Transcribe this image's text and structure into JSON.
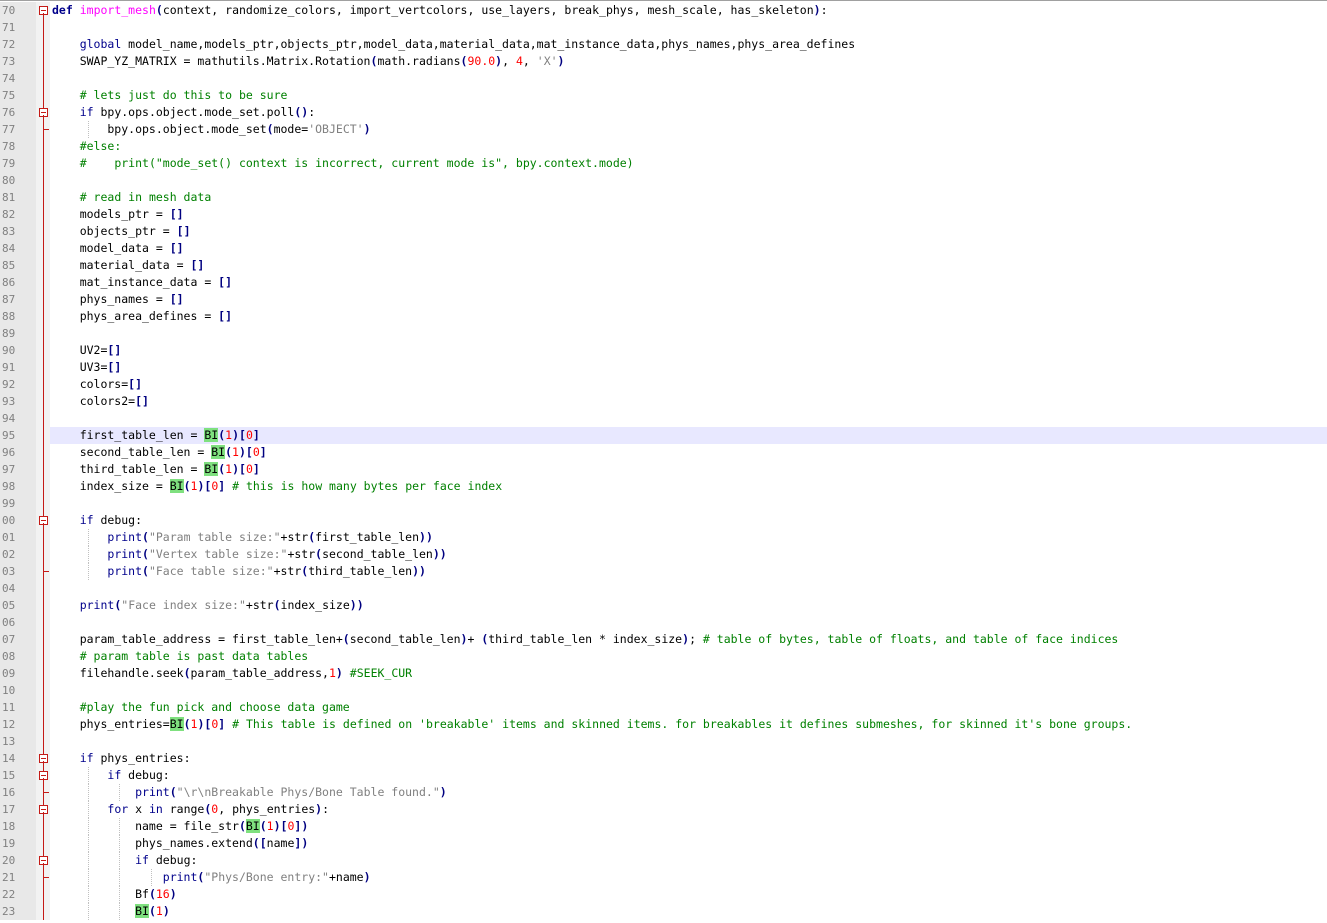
{
  "editor": {
    "lines": [
      {
        "num": "70",
        "fold": "box",
        "code": "def import_mesh(context, randomize_colors, import_vertcolors, use_layers, break_phys, mesh_scale, has_skeleton):"
      },
      {
        "num": "71",
        "fold": "line",
        "code": ""
      },
      {
        "num": "72",
        "fold": "line",
        "code": "    global model_name,models_ptr,objects_ptr,model_data,material_data,mat_instance_data,phys_names,phys_area_defines"
      },
      {
        "num": "73",
        "fold": "line",
        "code": "    SWAP_YZ_MATRIX = mathutils.Matrix.Rotation(math.radians(90.0), 4, 'X')"
      },
      {
        "num": "74",
        "fold": "line",
        "code": ""
      },
      {
        "num": "75",
        "fold": "line",
        "code": "    # lets just do this to be sure"
      },
      {
        "num": "76",
        "fold": "box",
        "code": "    if bpy.ops.object.mode_set.poll():"
      },
      {
        "num": "77",
        "fold": "end",
        "code": "        bpy.ops.object.mode_set(mode='OBJECT')"
      },
      {
        "num": "78",
        "fold": "line",
        "code": "    #else:"
      },
      {
        "num": "79",
        "fold": "line",
        "code": "    #    print(\"mode_set() context is incorrect, current mode is\", bpy.context.mode)"
      },
      {
        "num": "80",
        "fold": "line",
        "code": ""
      },
      {
        "num": "81",
        "fold": "line",
        "code": "    # read in mesh data"
      },
      {
        "num": "82",
        "fold": "line",
        "code": "    models_ptr = []"
      },
      {
        "num": "83",
        "fold": "line",
        "code": "    objects_ptr = []"
      },
      {
        "num": "84",
        "fold": "line",
        "code": "    model_data = []"
      },
      {
        "num": "85",
        "fold": "line",
        "code": "    material_data = []"
      },
      {
        "num": "86",
        "fold": "line",
        "code": "    mat_instance_data = []"
      },
      {
        "num": "87",
        "fold": "line",
        "code": "    phys_names = []"
      },
      {
        "num": "88",
        "fold": "line",
        "code": "    phys_area_defines = []"
      },
      {
        "num": "89",
        "fold": "line",
        "code": ""
      },
      {
        "num": "90",
        "fold": "line",
        "code": "    UV2=[]"
      },
      {
        "num": "91",
        "fold": "line",
        "code": "    UV3=[]"
      },
      {
        "num": "92",
        "fold": "line",
        "code": "    colors=[]"
      },
      {
        "num": "93",
        "fold": "line",
        "code": "    colors2=[]"
      },
      {
        "num": "94",
        "fold": "line",
        "code": ""
      },
      {
        "num": "95",
        "fold": "line",
        "code": "    first_table_len = BI(1)[0]",
        "highlight": true
      },
      {
        "num": "96",
        "fold": "line",
        "code": "    second_table_len = BI(1)[0]"
      },
      {
        "num": "97",
        "fold": "line",
        "code": "    third_table_len = BI(1)[0]"
      },
      {
        "num": "98",
        "fold": "line",
        "code": "    index_size = BI(1)[0] # this is how many bytes per face index"
      },
      {
        "num": "99",
        "fold": "line",
        "code": ""
      },
      {
        "num": "00",
        "fold": "box",
        "code": "    if debug:"
      },
      {
        "num": "01",
        "fold": "line",
        "code": "        print(\"Param table size:\"+str(first_table_len))"
      },
      {
        "num": "02",
        "fold": "line",
        "code": "        print(\"Vertex table size:\"+str(second_table_len))"
      },
      {
        "num": "03",
        "fold": "end",
        "code": "        print(\"Face table size:\"+str(third_table_len))"
      },
      {
        "num": "04",
        "fold": "line",
        "code": ""
      },
      {
        "num": "05",
        "fold": "line",
        "code": "    print(\"Face index size:\"+str(index_size))"
      },
      {
        "num": "06",
        "fold": "line",
        "code": ""
      },
      {
        "num": "07",
        "fold": "line",
        "code": "    param_table_address = first_table_len+(second_table_len)+ (third_table_len * index_size); # table of bytes, table of floats, and table of face indices"
      },
      {
        "num": "08",
        "fold": "line",
        "code": "    # param table is past data tables"
      },
      {
        "num": "09",
        "fold": "line",
        "code": "    filehandle.seek(param_table_address,1) #SEEK_CUR"
      },
      {
        "num": "10",
        "fold": "line",
        "code": ""
      },
      {
        "num": "11",
        "fold": "line",
        "code": "    #play the fun pick and choose data game"
      },
      {
        "num": "12",
        "fold": "line",
        "code": "    phys_entries=BI(1)[0] # This table is defined on 'breakable' items and skinned items. for breakables it defines submeshes, for skinned it's bone groups."
      },
      {
        "num": "13",
        "fold": "line",
        "code": ""
      },
      {
        "num": "14",
        "fold": "box",
        "code": "    if phys_entries:"
      },
      {
        "num": "15",
        "fold": "box",
        "code": "        if debug:"
      },
      {
        "num": "16",
        "fold": "end",
        "code": "            print(\"\\r\\nBreakable Phys/Bone Table found.\")"
      },
      {
        "num": "17",
        "fold": "box",
        "code": "        for x in range(0, phys_entries):"
      },
      {
        "num": "18",
        "fold": "line",
        "code": "            name = file_str(BI(1)[0])"
      },
      {
        "num": "19",
        "fold": "line",
        "code": "            phys_names.extend([name])"
      },
      {
        "num": "20",
        "fold": "box",
        "code": "            if debug:"
      },
      {
        "num": "21",
        "fold": "end",
        "code": "                print(\"Phys/Bone entry:\"+name)"
      },
      {
        "num": "22",
        "fold": "line",
        "code": "            Bf(16)"
      },
      {
        "num": "23",
        "fold": "line",
        "code": "            BI(1)"
      }
    ]
  }
}
